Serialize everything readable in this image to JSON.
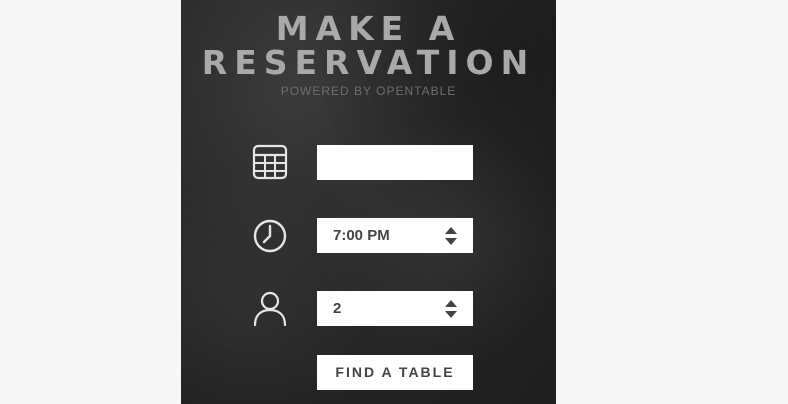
{
  "header": {
    "title_line1": "MAKE A",
    "title_line2": "RESERVATION",
    "subtitle": "POWERED BY OPENTABLE"
  },
  "form": {
    "date": {
      "icon": "calendar-icon",
      "value": ""
    },
    "time": {
      "icon": "clock-icon",
      "value": "7:00 PM"
    },
    "party_size": {
      "icon": "person-icon",
      "value": "2"
    },
    "submit_label": "FIND A TABLE"
  },
  "colors": {
    "panel_background": "#2b2b2b",
    "title_text": "#a9a9a9",
    "subtitle_text": "#6e6e6e",
    "field_background": "#ffffff",
    "field_text": "#444444"
  }
}
